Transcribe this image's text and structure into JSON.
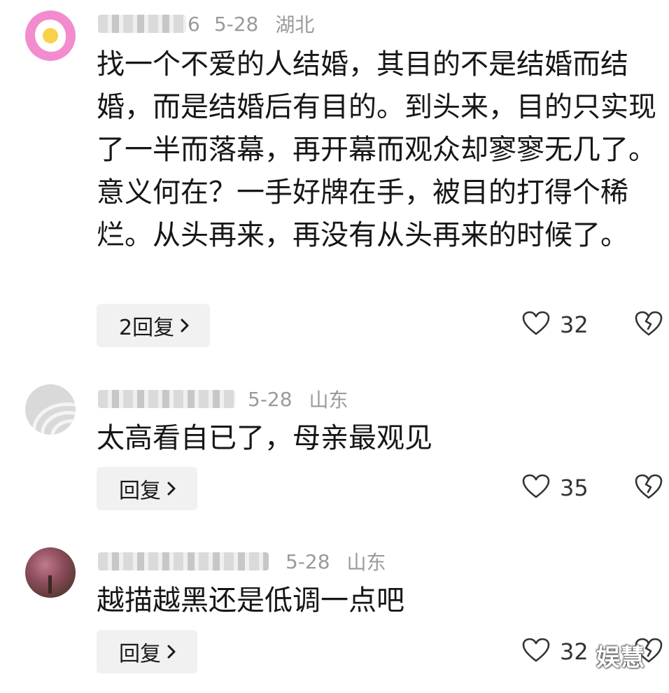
{
  "comments": [
    {
      "name_suffix": "6",
      "date": "5-28",
      "location": "湖北",
      "text": "找一个不爱的人结婚，其目的不是结婚而结婚，而是结婚后有目的。到头来，目的只实现了一半而落幕，再开幕而观众却寥寥无几了。意义何在？一手好牌在手，被目的打得个稀烂。从头再来，再没有从头再来的时候了。",
      "reply_label": "2回复",
      "likes": "32",
      "avatar_icon": "egg-avatar"
    },
    {
      "name_suffix": "",
      "date": "5-28",
      "location": "山东",
      "text": "太高看自已了，母亲最观见",
      "reply_label": "回复",
      "likes": "35",
      "avatar_icon": "waves-avatar"
    },
    {
      "name_suffix": "",
      "date": "5-28",
      "location": "山东",
      "text": "越描越黑还是低调一点吧",
      "reply_label": "回复",
      "likes": "32",
      "avatar_icon": "blossom-tree-avatar"
    }
  ],
  "watermark": "娱慧",
  "colors": {
    "meta_gray": "#9a9a9a",
    "text": "#161616",
    "reply_bg": "#f1f1f1",
    "avatar_pink": "#f28ccf"
  }
}
